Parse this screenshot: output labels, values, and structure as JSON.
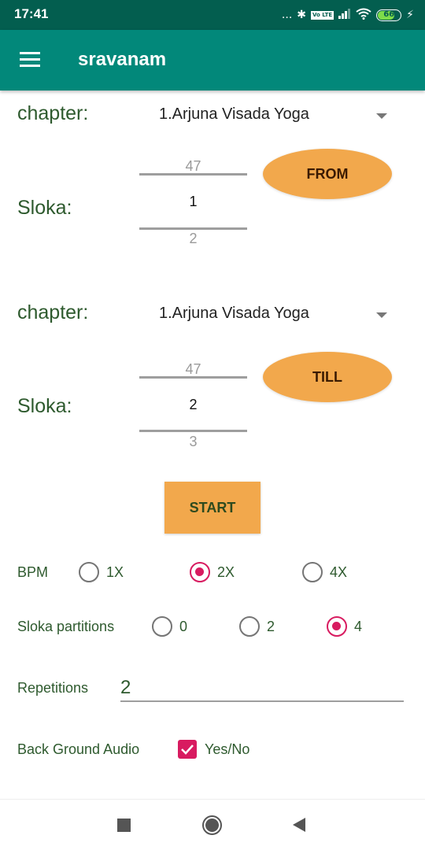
{
  "status_bar": {
    "time": "17:41",
    "dots": "...",
    "bluetooth": "bluetooth-icon",
    "volte": "Vo LTE",
    "signal": "signal-icon",
    "wifi": "wifi-icon",
    "battery_level": "66",
    "charging": "charging-icon"
  },
  "app_bar": {
    "menu_icon": "hamburger-menu-icon",
    "title": "sravanam"
  },
  "from_section": {
    "chapter_label": "chapter:",
    "chapter_value": "1.Arjuna Visada Yoga",
    "sloka_label": "Sloka:",
    "picker": {
      "prev": "47",
      "current": "1",
      "next": "2"
    },
    "button_label": "FROM"
  },
  "till_section": {
    "chapter_label": "chapter:",
    "chapter_value": "1.Arjuna Visada Yoga",
    "sloka_label": "Sloka:",
    "picker": {
      "prev": "47",
      "current": "2",
      "next": "3"
    },
    "button_label": "TILL"
  },
  "start_button": "START",
  "bpm": {
    "label": "BPM",
    "options": [
      {
        "label": "1X",
        "checked": false
      },
      {
        "label": "2X",
        "checked": true
      },
      {
        "label": "4X",
        "checked": false
      }
    ]
  },
  "partitions": {
    "label": "Sloka partitions",
    "options": [
      {
        "label": "0",
        "checked": false
      },
      {
        "label": "2",
        "checked": false
      },
      {
        "label": "4",
        "checked": true
      }
    ]
  },
  "repetitions": {
    "label": "Repetitions",
    "value": "2"
  },
  "background_audio": {
    "label": "Back Ground Audio",
    "checkbox_label": "Yes/No",
    "checked": true
  },
  "colors": {
    "status_bar": "#035e4f",
    "app_bar": "#02887a",
    "accent": "#d81b60",
    "button": "#f2a84c",
    "label_text": "#2e5a2e"
  }
}
